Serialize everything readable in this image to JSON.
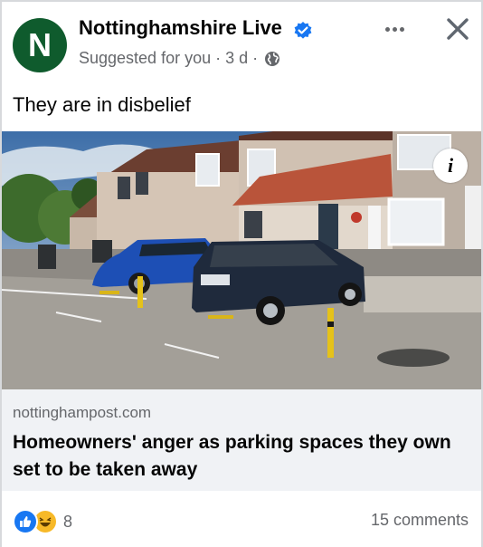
{
  "post": {
    "page_name": "Nottinghamshire Live",
    "avatar_letter": "N",
    "suggested": "Suggested for you",
    "time": "3 d",
    "text": "They are in disbelief"
  },
  "link": {
    "domain": "nottinghampost.com",
    "title": "Homeowners' anger as parking spaces they own set to be taken away"
  },
  "footer": {
    "reaction_count": "8",
    "comments": "15 comments"
  },
  "icons": {
    "verified": "verified-badge-icon",
    "audience": "globe-icon",
    "more": "more-icon",
    "close": "close-icon",
    "info": "info-icon",
    "reactions": [
      "like-icon",
      "haha-icon"
    ]
  },
  "colors": {
    "avatar": "#0f5b2d",
    "verified": "#1877f2",
    "secondary_text": "#65676b",
    "link_box": "#f0f2f5"
  }
}
